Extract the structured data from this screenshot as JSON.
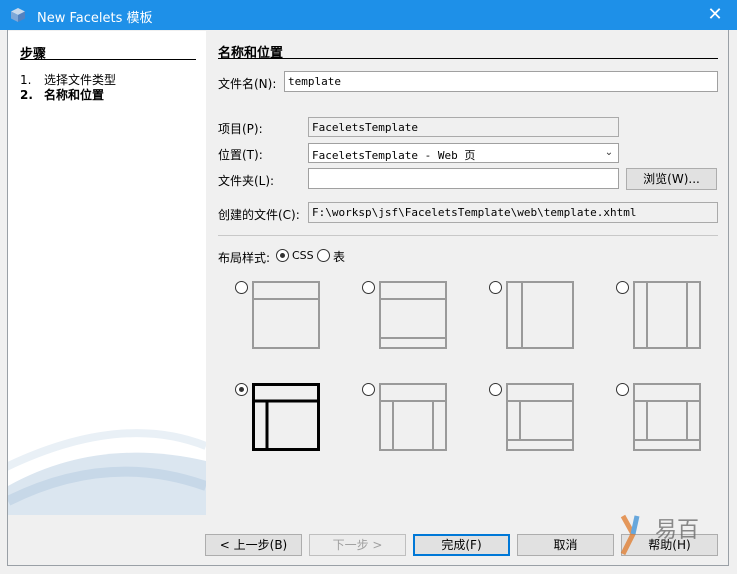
{
  "window": {
    "title": "New Facelets 模板",
    "close_icon": "close-icon"
  },
  "steps": {
    "header": "步骤",
    "items": [
      {
        "num": "1.",
        "label": "选择文件类型"
      },
      {
        "num": "2.",
        "label": "名称和位置"
      }
    ]
  },
  "main": {
    "header": "名称和位置"
  },
  "form": {
    "filename_label": "文件名(N):",
    "filename_value": "template",
    "project_label": "项目(P):",
    "project_value": "FaceletsTemplate",
    "location_label": "位置(T):",
    "location_value": "FaceletsTemplate - Web 页",
    "folder_label": "文件夹(L):",
    "folder_value": "",
    "browse_label": "浏览(W)...",
    "created_label": "创建的文件(C):",
    "created_value": "F:\\worksp\\jsf\\FaceletsTemplate\\web\\template.xhtml"
  },
  "layout_style": {
    "label": "布局样式:",
    "options": [
      {
        "label": "CSS",
        "selected": true
      },
      {
        "label": "表",
        "selected": false
      }
    ],
    "selected_template_index": 4
  },
  "buttons": {
    "back": "< 上一步(B)",
    "next": "下一步 >",
    "finish": "完成(F)",
    "cancel": "取消",
    "help": "帮助(H)"
  },
  "watermark": {
    "text": "易百"
  },
  "colors": {
    "titlebar": "#1e90e8",
    "accent": "#0078d7"
  }
}
